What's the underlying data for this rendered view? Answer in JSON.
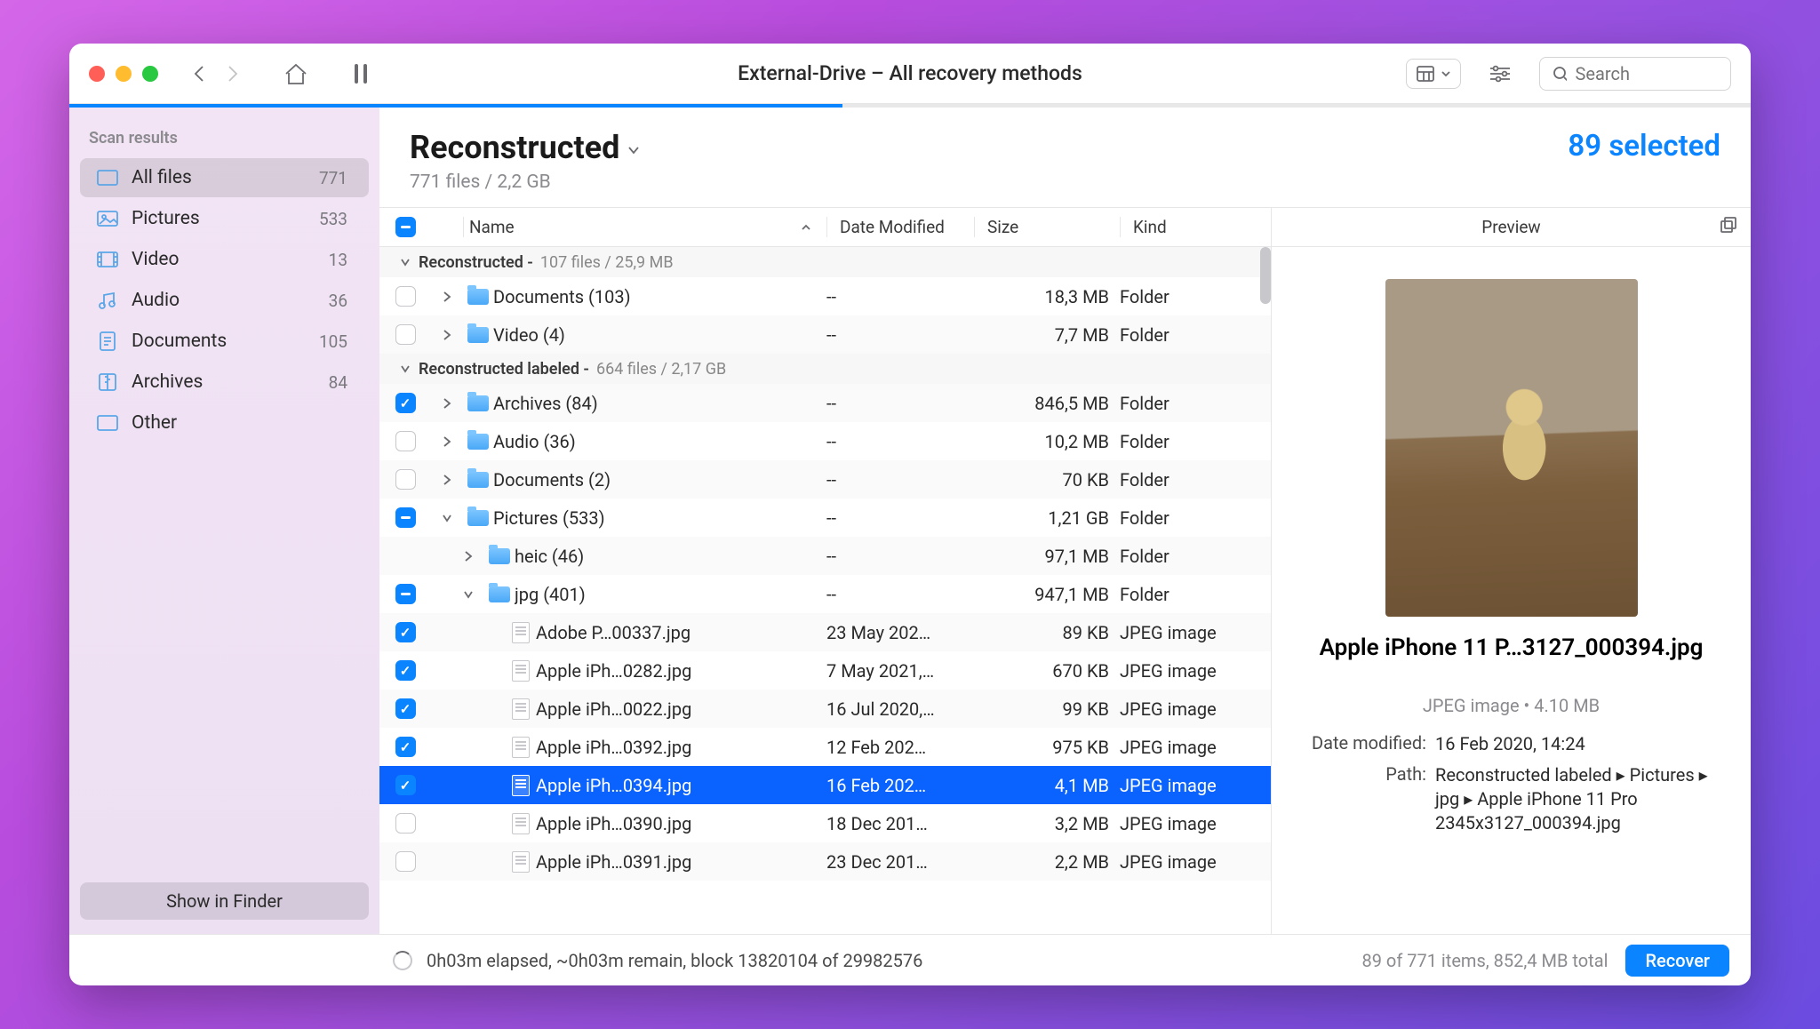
{
  "window_title": "External-Drive – All recovery methods",
  "search_placeholder": "Search",
  "progress_pct": 46,
  "sidebar": {
    "header": "Scan results",
    "items": [
      {
        "label": "All files",
        "count": "771",
        "icon": "all-files"
      },
      {
        "label": "Pictures",
        "count": "533",
        "icon": "pictures"
      },
      {
        "label": "Video",
        "count": "13",
        "icon": "video"
      },
      {
        "label": "Audio",
        "count": "36",
        "icon": "audio"
      },
      {
        "label": "Documents",
        "count": "105",
        "icon": "documents"
      },
      {
        "label": "Archives",
        "count": "84",
        "icon": "archives"
      },
      {
        "label": "Other",
        "count": "",
        "icon": "other"
      }
    ],
    "show_in_finder": "Show in Finder"
  },
  "main": {
    "title": "Reconstructed",
    "subtitle": "771 files / 2,2 GB",
    "selected_label": "89 selected",
    "columns": {
      "name": "Name",
      "date": "Date Modified",
      "size": "Size",
      "kind": "Kind"
    },
    "groups": [
      {
        "label": "Reconstructed - ",
        "meta": "107 files / 25,9 MB"
      },
      {
        "label": "Reconstructed labeled - ",
        "meta": "664 files / 2,17 GB"
      }
    ],
    "rows": [
      {
        "grp": 0,
        "check": "off",
        "chev": "r",
        "ind": 0,
        "type": "folder",
        "name": "Documents (103)",
        "date": "--",
        "size": "18,3 MB",
        "kind": "Folder"
      },
      {
        "grp": 0,
        "check": "off",
        "chev": "r",
        "ind": 0,
        "type": "folder",
        "name": "Video (4)",
        "date": "--",
        "size": "7,7 MB",
        "kind": "Folder"
      },
      {
        "grp": 1,
        "check": "on",
        "chev": "r",
        "ind": 0,
        "type": "folder",
        "name": "Archives (84)",
        "date": "--",
        "size": "846,5 MB",
        "kind": "Folder"
      },
      {
        "grp": 1,
        "check": "off",
        "chev": "r",
        "ind": 0,
        "type": "folder",
        "name": "Audio (36)",
        "date": "--",
        "size": "10,2 MB",
        "kind": "Folder"
      },
      {
        "grp": 1,
        "check": "off",
        "chev": "r",
        "ind": 0,
        "type": "folder",
        "name": "Documents (2)",
        "date": "--",
        "size": "70 KB",
        "kind": "Folder"
      },
      {
        "grp": 1,
        "check": "part",
        "chev": "d",
        "ind": 0,
        "type": "folder",
        "name": "Pictures (533)",
        "date": "--",
        "size": "1,21 GB",
        "kind": "Folder"
      },
      {
        "grp": 1,
        "check": "none",
        "chev": "r",
        "ind": 1,
        "type": "folder",
        "name": "heic (46)",
        "date": "--",
        "size": "97,1 MB",
        "kind": "Folder"
      },
      {
        "grp": 1,
        "check": "part",
        "chev": "d",
        "ind": 1,
        "type": "folder",
        "name": "jpg (401)",
        "date": "--",
        "size": "947,1 MB",
        "kind": "Folder"
      },
      {
        "grp": 1,
        "check": "on",
        "chev": "",
        "ind": 2,
        "type": "file",
        "name": "Adobe P…00337.jpg",
        "date": "23 May 202…",
        "size": "89 KB",
        "kind": "JPEG image"
      },
      {
        "grp": 1,
        "check": "on",
        "chev": "",
        "ind": 2,
        "type": "file",
        "name": "Apple iPh…0282.jpg",
        "date": "7 May 2021,…",
        "size": "670 KB",
        "kind": "JPEG image"
      },
      {
        "grp": 1,
        "check": "on",
        "chev": "",
        "ind": 2,
        "type": "file",
        "name": "Apple iPh…0022.jpg",
        "date": "16 Jul 2020,…",
        "size": "99 KB",
        "kind": "JPEG image"
      },
      {
        "grp": 1,
        "check": "on",
        "chev": "",
        "ind": 2,
        "type": "file",
        "name": "Apple iPh…0392.jpg",
        "date": "12 Feb 202…",
        "size": "975 KB",
        "kind": "JPEG image"
      },
      {
        "grp": 1,
        "check": "on",
        "chev": "",
        "ind": 2,
        "type": "file",
        "name": "Apple iPh…0394.jpg",
        "date": "16 Feb 202…",
        "size": "4,1 MB",
        "kind": "JPEG image",
        "selected": true
      },
      {
        "grp": 1,
        "check": "off",
        "chev": "",
        "ind": 2,
        "type": "file",
        "name": "Apple iPh…0390.jpg",
        "date": "18 Dec 201…",
        "size": "3,2 MB",
        "kind": "JPEG image"
      },
      {
        "grp": 1,
        "check": "off",
        "chev": "",
        "ind": 2,
        "type": "file",
        "name": "Apple iPh…0391.jpg",
        "date": "23 Dec 201…",
        "size": "2,2 MB",
        "kind": "JPEG image"
      }
    ]
  },
  "preview": {
    "header": "Preview",
    "file_title": "Apple iPhone 11 P…3127_000394.jpg",
    "subtitle": "JPEG image • 4.10 MB",
    "date_label": "Date modified:",
    "date_value": "16 Feb 2020, 14:24",
    "path_label": "Path:",
    "path_value": "Reconstructed labeled ▸ Pictures ▸ jpg ▸ Apple iPhone 11 Pro 2345x3127_000394.jpg"
  },
  "footer": {
    "status": "0h03m elapsed, ~0h03m remain, block 13820104 of 29982576",
    "summary": "89 of 771 items, 852,4 MB total",
    "recover": "Recover"
  }
}
